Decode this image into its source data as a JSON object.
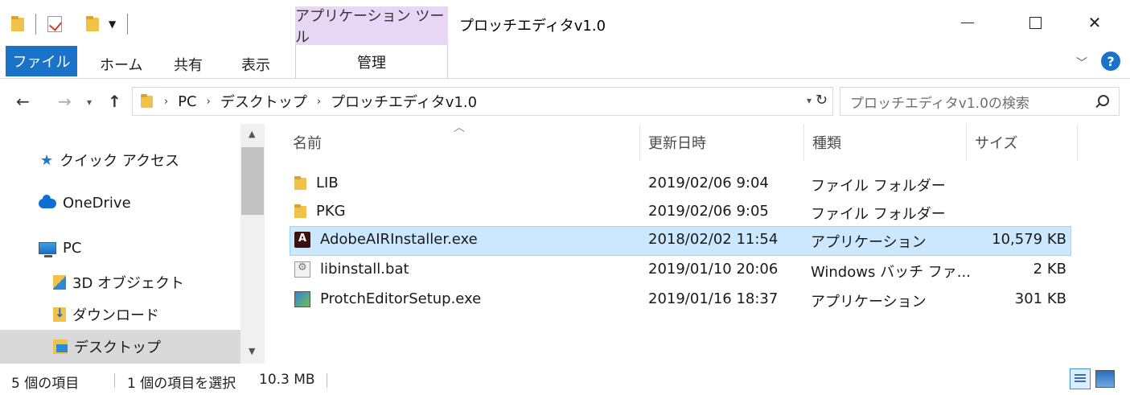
{
  "window": {
    "title": "プロッチエディタv1.0",
    "context_tab_group": "アプリケーション ツール",
    "close_glyph": "✕"
  },
  "ribbon": {
    "tabs": [
      "ファイル",
      "ホーム",
      "共有",
      "表示"
    ],
    "context_tab": "管理",
    "help": "?"
  },
  "address": {
    "crumbs": [
      "PC",
      "デスクトップ",
      "プロッチエディタv1.0"
    ],
    "search_placeholder": "プロッチエディタv1.0の検索"
  },
  "nav_pane": {
    "items": [
      {
        "label": "クイック アクセス",
        "icon": "star-icon"
      },
      {
        "label": "OneDrive",
        "icon": "cloud-icon"
      },
      {
        "label": "PC",
        "icon": "pc-icon"
      },
      {
        "label": "3D オブジェクト",
        "icon": "3d-objects-icon"
      },
      {
        "label": "ダウンロード",
        "icon": "downloads-icon"
      },
      {
        "label": "デスクトップ",
        "icon": "desktop-folder-icon",
        "selected": true
      }
    ]
  },
  "columns": {
    "name": "名前",
    "modified": "更新日時",
    "type": "種類",
    "size": "サイズ"
  },
  "files": [
    {
      "name": "LIB",
      "modified": "2019/02/06 9:04",
      "type": "ファイル フォルダー",
      "size": "",
      "icon": "folder-icon"
    },
    {
      "name": "PKG",
      "modified": "2019/02/06 9:05",
      "type": "ファイル フォルダー",
      "size": "",
      "icon": "folder-icon"
    },
    {
      "name": "AdobeAIRInstaller.exe",
      "modified": "2018/02/02 11:54",
      "type": "アプリケーション",
      "size": "10,579 KB",
      "icon": "adobe-air-icon",
      "selected": true
    },
    {
      "name": "libinstall.bat",
      "modified": "2019/01/10 20:06",
      "type": "Windows バッチ ファ...",
      "size": "2 KB",
      "icon": "batch-file-icon"
    },
    {
      "name": "ProtchEditorSetup.exe",
      "modified": "2019/01/16 18:37",
      "type": "アプリケーション",
      "size": "301 KB",
      "icon": "setup-icon"
    }
  ],
  "status": {
    "item_count": "5 個の項目",
    "selection": "1 個の項目を選択",
    "selection_size": "10.3 MB"
  },
  "colors": {
    "accent": "#1a73c9",
    "context_tab": "#e8d6f5",
    "selection": "#cce8ff",
    "folder": "#f0c24a"
  }
}
